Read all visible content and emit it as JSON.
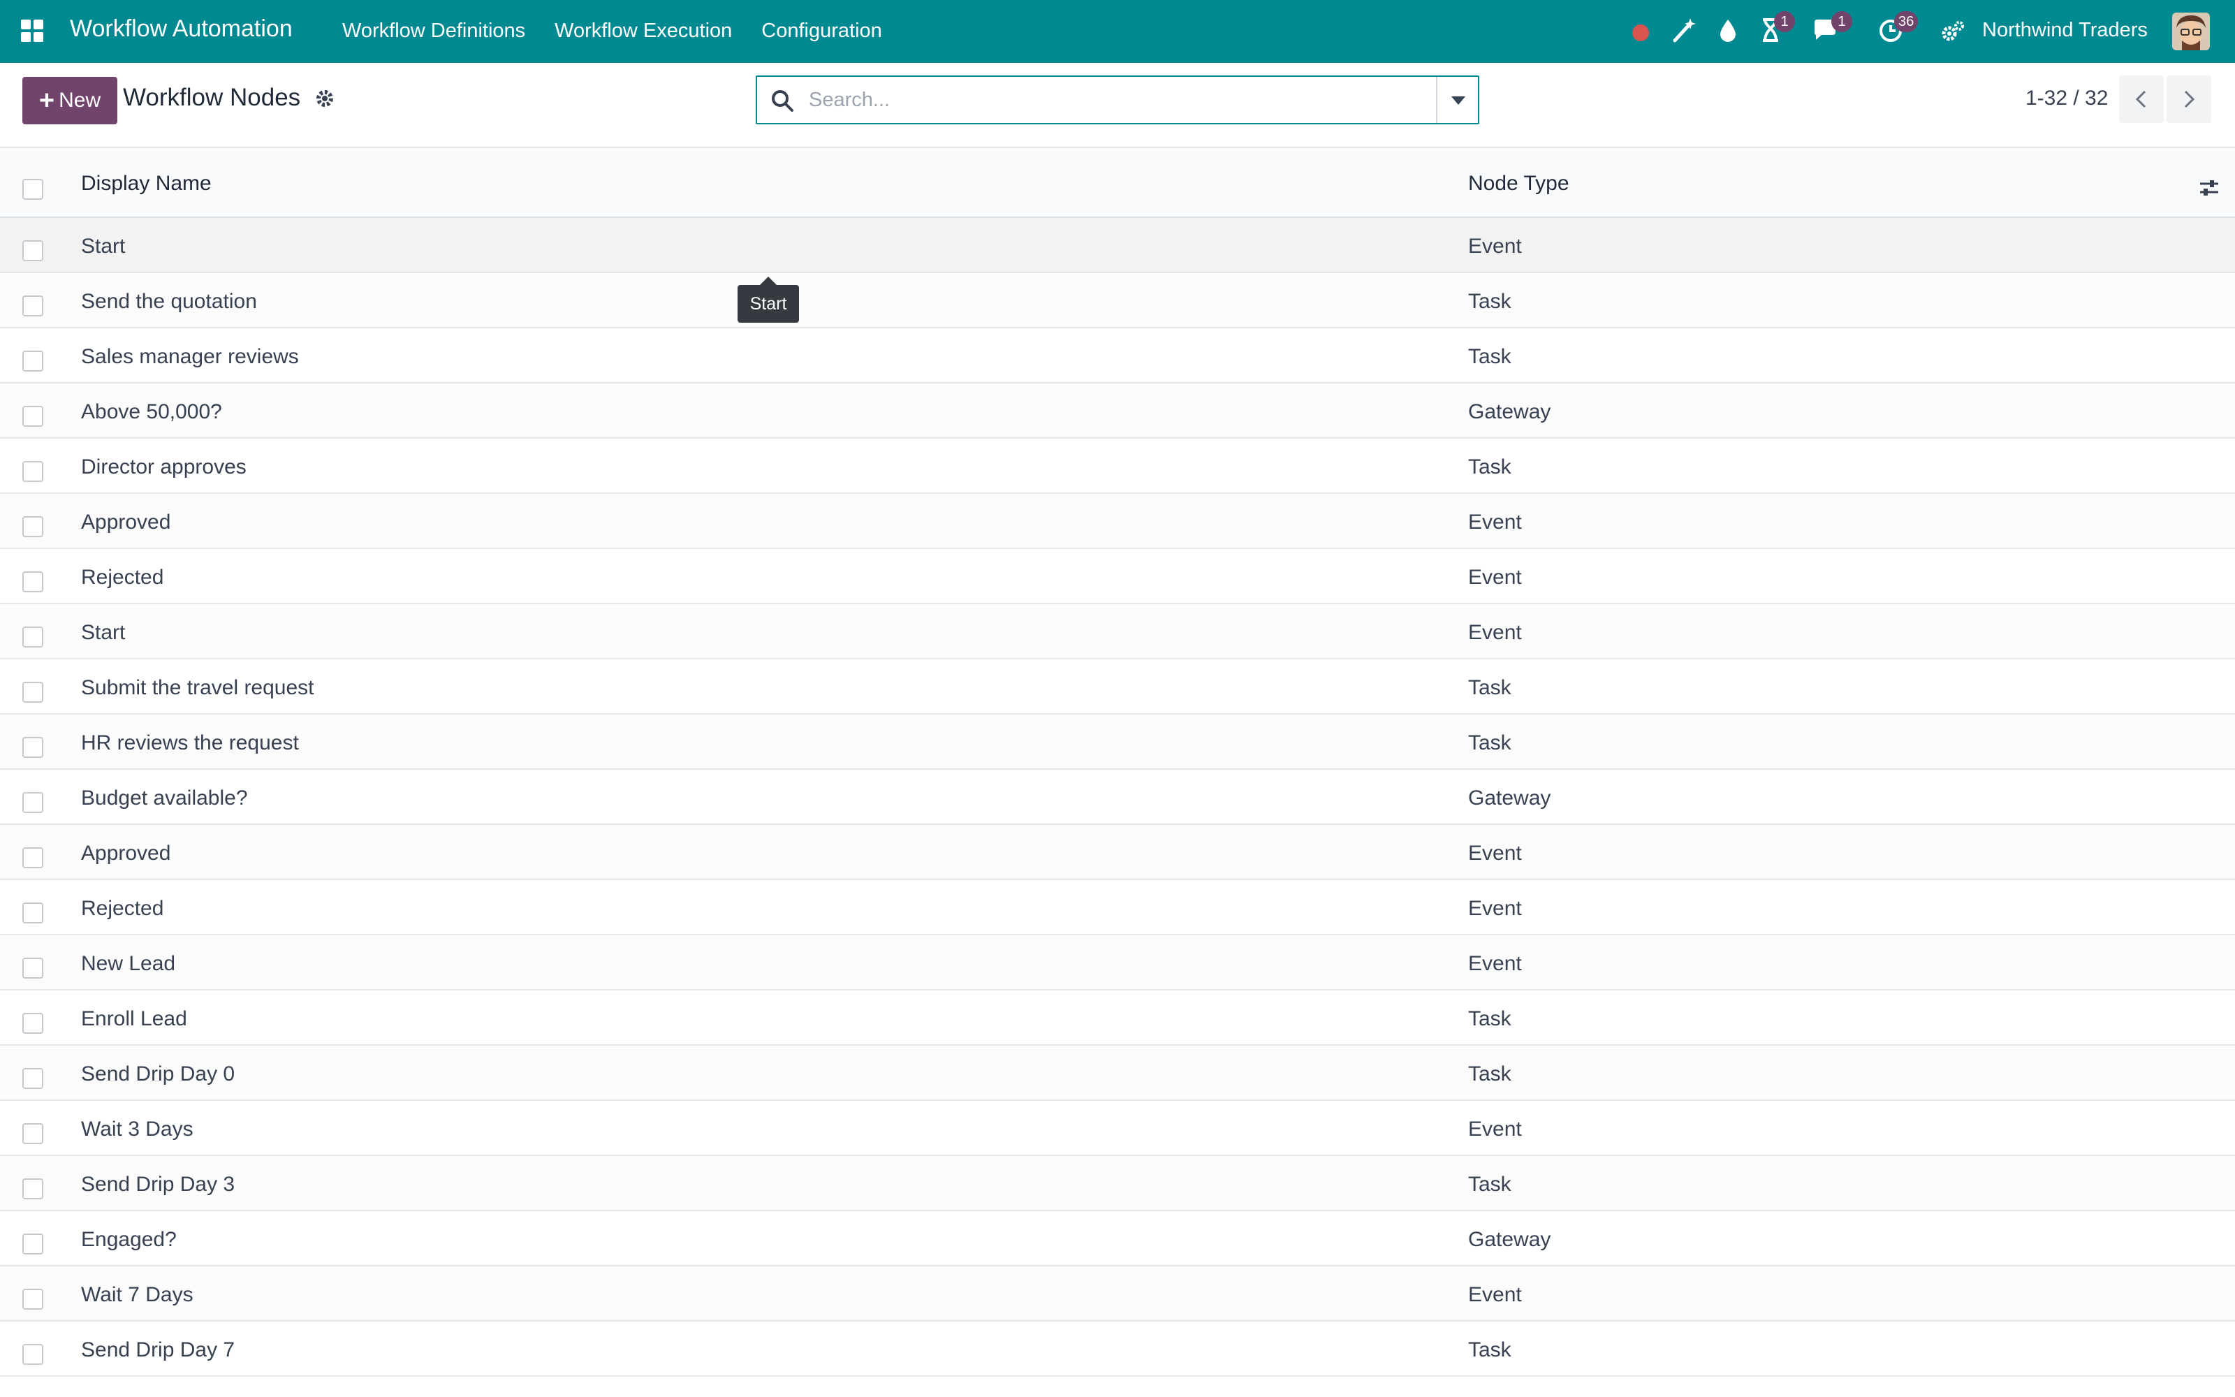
{
  "navbar": {
    "brand": "Workflow Automation",
    "menu": [
      "Workflow Definitions",
      "Workflow Execution",
      "Configuration"
    ],
    "company": "Northwind Traders",
    "badges": {
      "activities": "1",
      "messages": "1",
      "updates": "36"
    },
    "colors": {
      "bar": "#018992",
      "badge": "#71446b",
      "record_dot": "#d9534f"
    },
    "icons": [
      "apps-grid-icon",
      "record-dot-icon",
      "magic-wand-icon",
      "drop-icon",
      "hourglass-icon",
      "chat-icon",
      "clock-icon",
      "gears-icon"
    ]
  },
  "control_panel": {
    "new_label": "New",
    "title": "Workflow Nodes",
    "search_placeholder": "Search...",
    "pager": "1-32 / 32"
  },
  "list": {
    "columns": {
      "name": "Display Name",
      "type": "Node Type"
    },
    "rows": [
      {
        "name": "Start",
        "type": "Event"
      },
      {
        "name": "Send the quotation",
        "type": "Task"
      },
      {
        "name": "Sales manager reviews",
        "type": "Task"
      },
      {
        "name": "Above 50,000?",
        "type": "Gateway"
      },
      {
        "name": "Director approves",
        "type": "Task"
      },
      {
        "name": "Approved",
        "type": "Event"
      },
      {
        "name": "Rejected",
        "type": "Event"
      },
      {
        "name": "Start",
        "type": "Event"
      },
      {
        "name": "Submit the travel request",
        "type": "Task"
      },
      {
        "name": "HR reviews the request",
        "type": "Task"
      },
      {
        "name": "Budget available?",
        "type": "Gateway"
      },
      {
        "name": "Approved",
        "type": "Event"
      },
      {
        "name": "Rejected",
        "type": "Event"
      },
      {
        "name": "New Lead",
        "type": "Event"
      },
      {
        "name": "Enroll Lead",
        "type": "Task"
      },
      {
        "name": "Send Drip Day 0",
        "type": "Task"
      },
      {
        "name": "Wait 3 Days",
        "type": "Event"
      },
      {
        "name": "Send Drip Day 3",
        "type": "Task"
      },
      {
        "name": "Engaged?",
        "type": "Gateway"
      },
      {
        "name": "Wait 7 Days",
        "type": "Event"
      },
      {
        "name": "Send Drip Day 7",
        "type": "Task"
      }
    ]
  },
  "tooltip": {
    "text": "Start"
  }
}
